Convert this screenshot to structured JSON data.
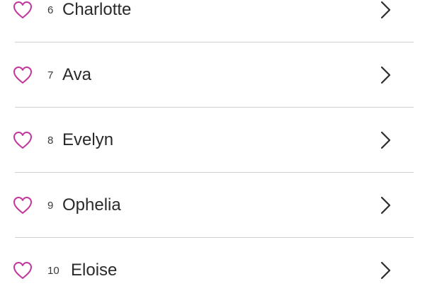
{
  "colors": {
    "heart": "#c2369b",
    "chevron": "#2b2b2b",
    "divider": "#cfcfcf"
  },
  "list": {
    "items": [
      {
        "rank": "6",
        "name": "Charlotte",
        "icon": "heart-outline-icon",
        "action_icon": "chevron-right-icon"
      },
      {
        "rank": "7",
        "name": "Ava",
        "icon": "heart-outline-icon",
        "action_icon": "chevron-right-icon"
      },
      {
        "rank": "8",
        "name": "Evelyn",
        "icon": "heart-outline-icon",
        "action_icon": "chevron-right-icon"
      },
      {
        "rank": "9",
        "name": "Ophelia",
        "icon": "heart-outline-icon",
        "action_icon": "chevron-right-icon"
      },
      {
        "rank": "10",
        "name": "Eloise",
        "icon": "heart-outline-icon",
        "action_icon": "chevron-right-icon"
      }
    ]
  }
}
